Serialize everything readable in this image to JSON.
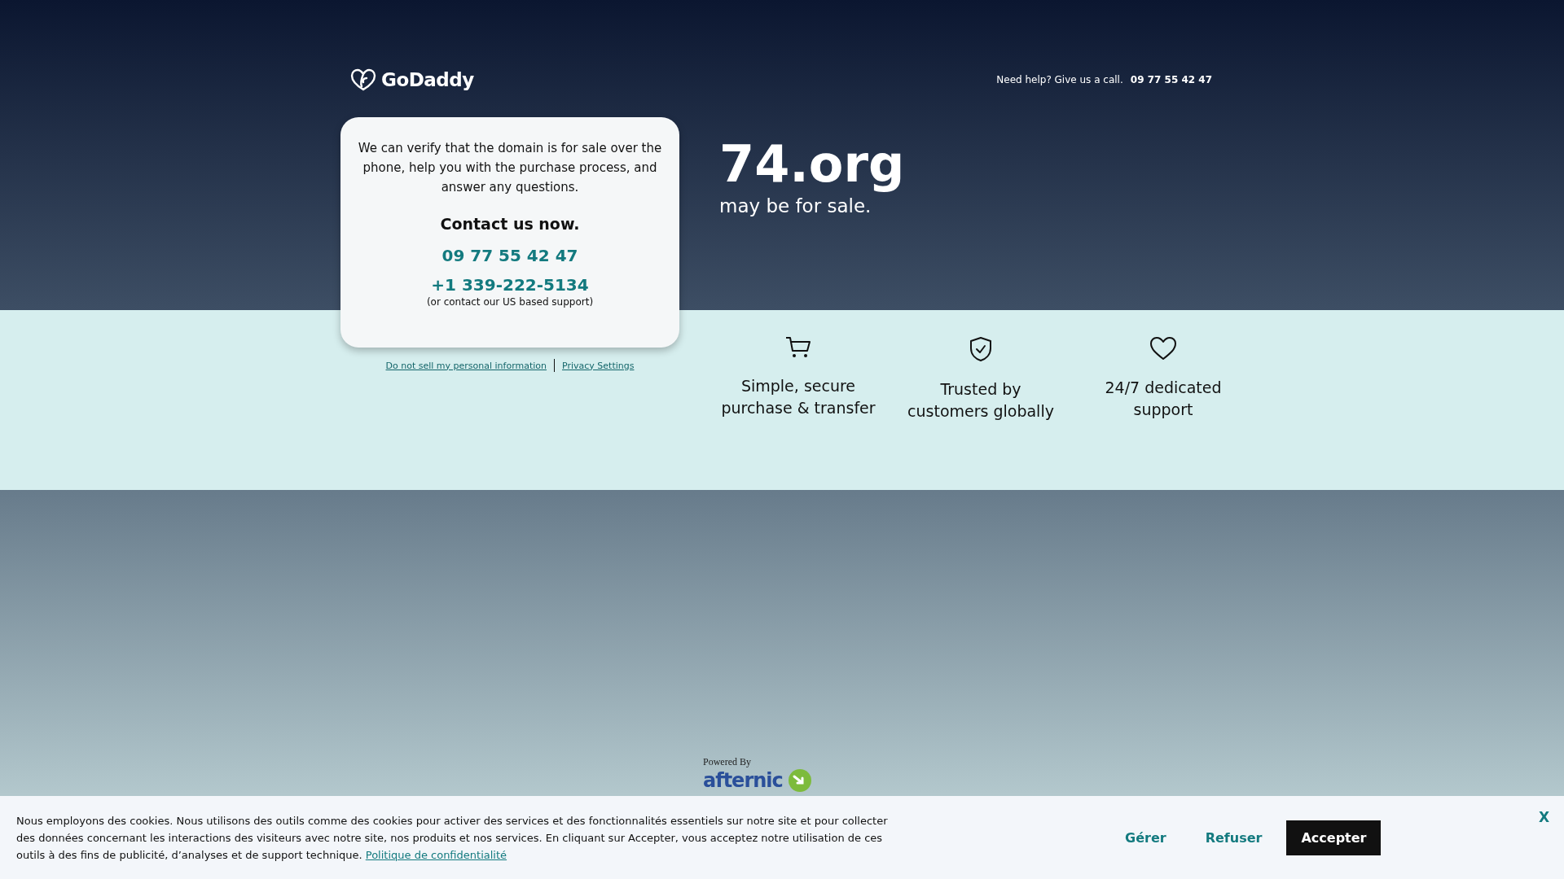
{
  "header": {
    "logo": "GoDaddy",
    "help_text": "Need help? Give us a call.",
    "help_phone": "09 77 55 42 47"
  },
  "card": {
    "intro": "We can verify that the domain is for sale over the phone, help you with the purchase process, and answer any questions.",
    "heading": "Contact us now.",
    "phone": "09 77 55 42 47",
    "us_phone": "+1 339-222-5134",
    "us_note": "(or contact our US based support)"
  },
  "legal_links": [
    "Do not sell my personal information",
    "Privacy Settings"
  ],
  "domain": {
    "name": "74.org",
    "subtitle": "may be for sale."
  },
  "features": [
    {
      "kind": "cart",
      "label": "Simple, secure purchase & transfer"
    },
    {
      "kind": "shield",
      "label": "Trusted by customers globally"
    },
    {
      "kind": "heart",
      "label": "24/7 dedicated support"
    }
  ],
  "powered_by": {
    "label": "Powered By",
    "logo": "afternic"
  },
  "cookie_bar": {
    "text": "Nous employons des cookies. Nous utilisons des outils comme des cookies pour activer des services et des fonctionnalités essentiels sur notre site et pour collecter des données concernant les interactions des visiteurs avec notre site, nos produits et nos services. En cliquant sur Accepter, vous acceptez notre utilisation de ces outils à des fins de publicité, d’analyses et de support technique.",
    "policy_link": "Politique de confidentialité",
    "buttons": [
      {
        "kind": "text",
        "label": "Gérer"
      },
      {
        "kind": "text",
        "label": "Refuser"
      },
      {
        "kind": "primary",
        "label": "Accepter"
      }
    ],
    "close": "X"
  }
}
